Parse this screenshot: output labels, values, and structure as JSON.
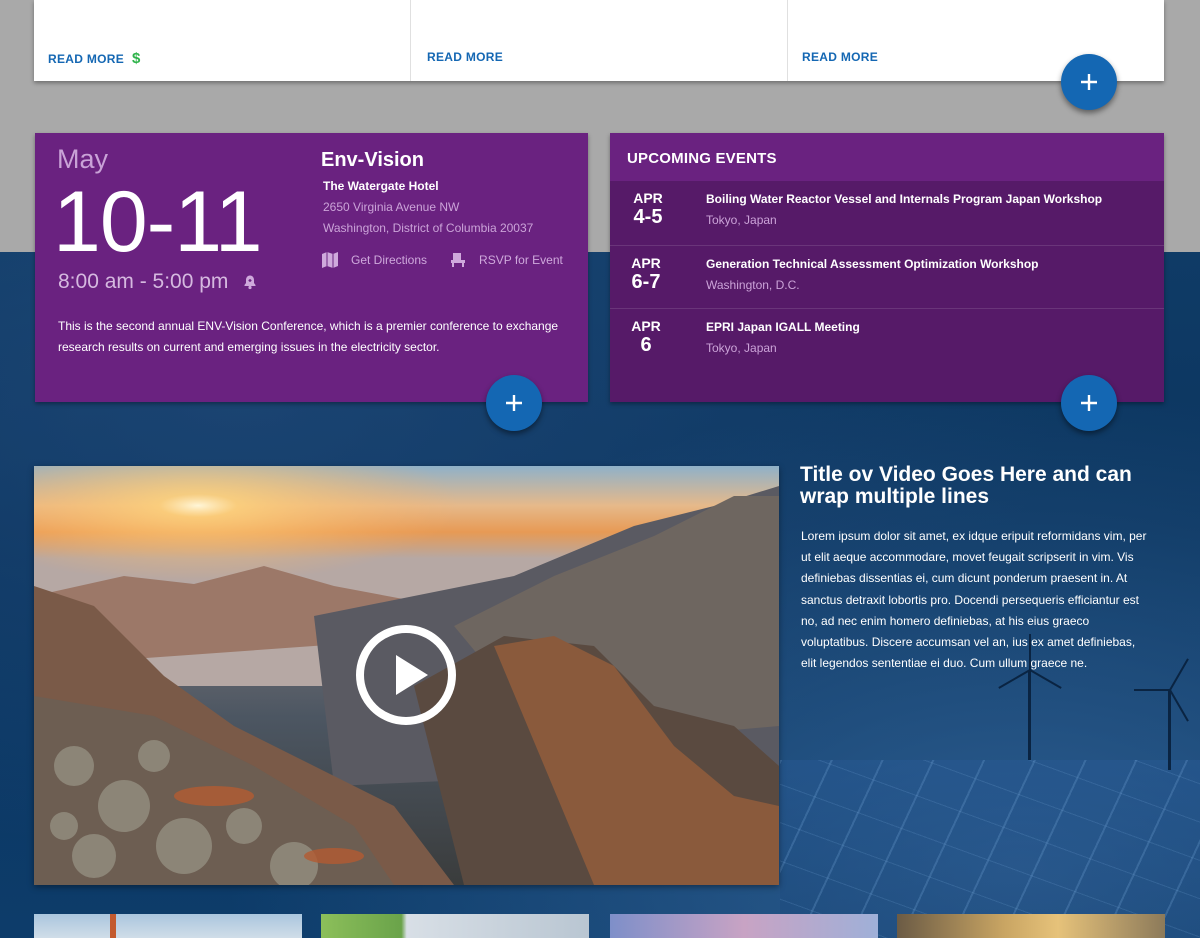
{
  "top_cards": [
    {
      "read_more": "READ MORE",
      "icon": "dollar-icon"
    },
    {
      "read_more": "READ MORE"
    },
    {
      "read_more": "READ MORE"
    }
  ],
  "dollar_glyph": "$",
  "event": {
    "month": "May",
    "days": "10-11",
    "time": "8:00 am - 5:00 pm",
    "name": "Env-Vision",
    "venue": "The Watergate Hotel",
    "address_line1": "2650 Virginia Avenue NW",
    "address_line2": "Washington, District of Columbia 20037",
    "get_directions": "Get Directions",
    "rsvp": "RSVP for Event",
    "description": "This is the second annual ENV-Vision Conference, which is a premier conference to exchange research results on current and emerging issues in the electricity sector."
  },
  "upcoming": {
    "header": "UPCOMING EVENTS",
    "items": [
      {
        "month": "APR",
        "days": "4-5",
        "title": "Boiling Water Reactor Vessel and Internals Program Japan Workshop",
        "location": "Tokyo, Japan"
      },
      {
        "month": "APR",
        "days": "6-7",
        "title": "Generation Technical Assessment Optimization Workshop",
        "location": "Washington, D.C."
      },
      {
        "month": "APR",
        "days": "6",
        "title": "EPRI Japan IGALL Meeting",
        "location": "Tokyo, Japan"
      }
    ]
  },
  "video": {
    "title": "Title ov Video Goes Here and can wrap multiple lines",
    "description": "Lorem ipsum dolor sit amet, ex idque eripuit reformidans vim, per ut elit aeque accommodare, movet feugait scripserit in vim. Vis definiebas dissentias ei, cum dicunt ponderum praesent in. At sanctus detraxit lobortis pro. Docendi persequeris efficiantur est no, ad nec enim homero definiebas, at his eius graeco voluptatibus. Discere accumsan vel an, ius ex amet definiebas, elit legendos sententiae ei duo. Cum ullum graece ne."
  },
  "colors": {
    "link_blue": "#1467b3",
    "purple": "#6a2280",
    "purple_dark": "#561a68",
    "dollar_green": "#2eb34a"
  }
}
